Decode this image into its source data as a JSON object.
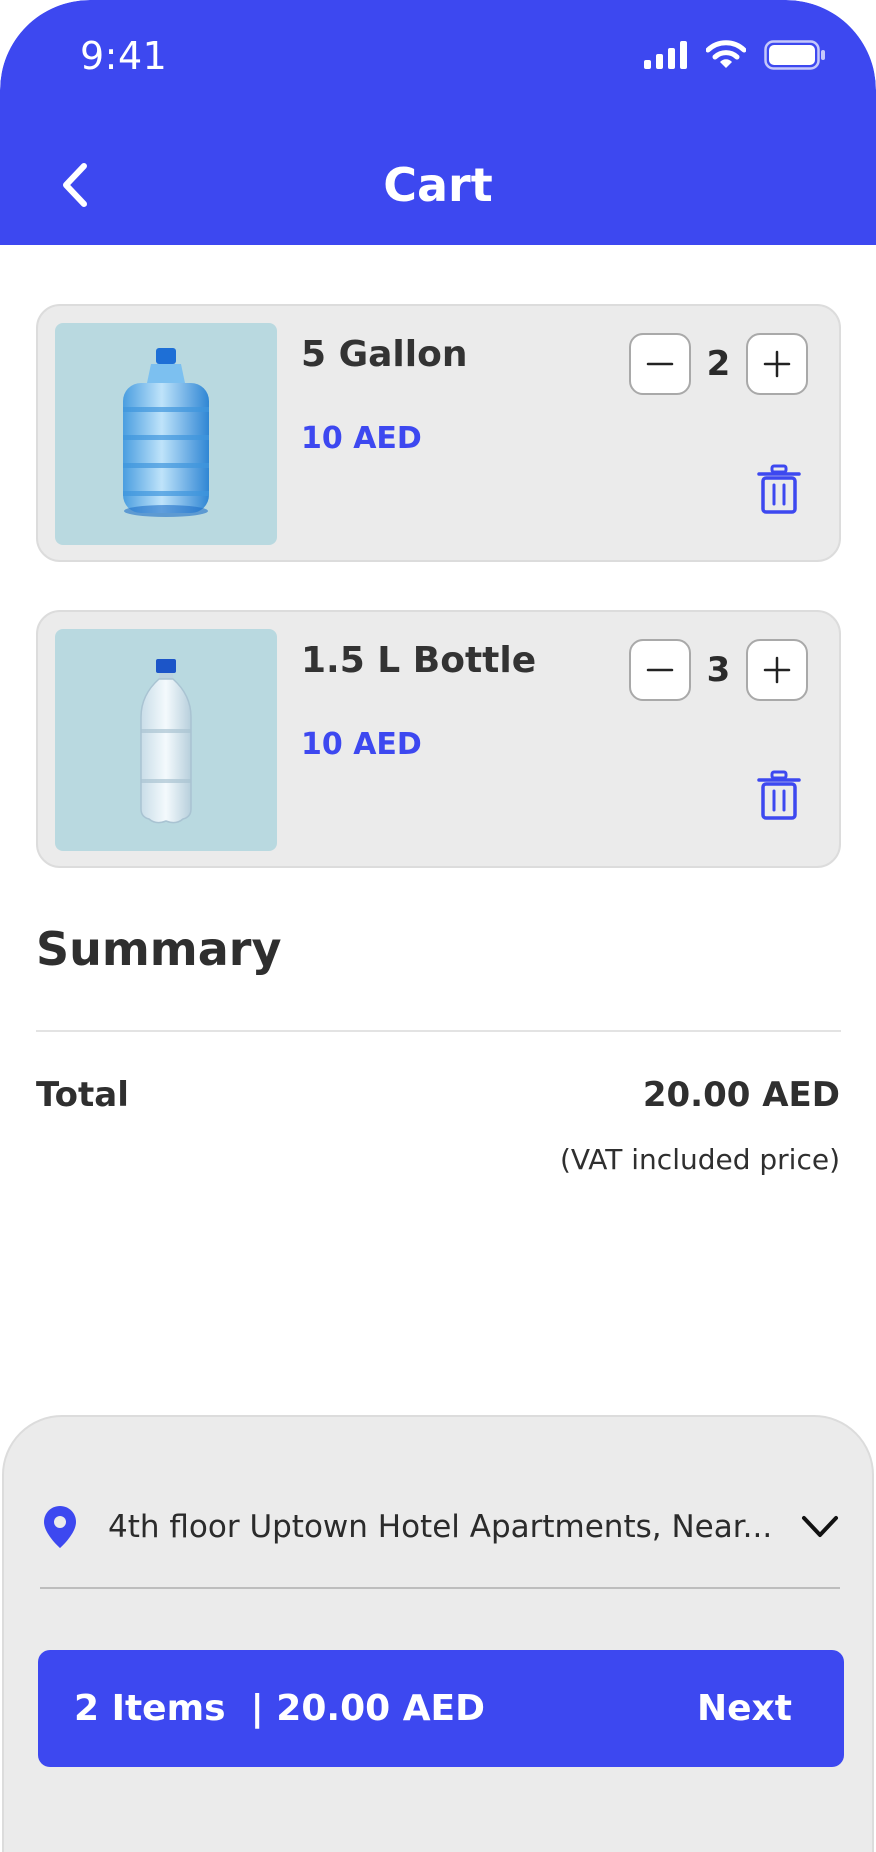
{
  "status_bar": {
    "time": "9:41"
  },
  "header": {
    "title": "Cart"
  },
  "cart": {
    "items": [
      {
        "name": "5 Gallon",
        "price": "10 AED",
        "quantity": "2"
      },
      {
        "name": "1.5 L Bottle",
        "price": "10 AED",
        "quantity": "3"
      }
    ]
  },
  "summary": {
    "title": "Summary",
    "total_label": "Total",
    "total_value": "20.00 AED",
    "vat_note": "(VAT included price)"
  },
  "checkout": {
    "address": "4th floor Uptown Hotel Apartments, Near...",
    "items_summary": "2 Items  | 20.00 AED",
    "next_label": "Next"
  },
  "colors": {
    "accent": "#3d48f0",
    "card_bg": "#ebebeb",
    "thumb_bg": "#b9d9e0"
  }
}
